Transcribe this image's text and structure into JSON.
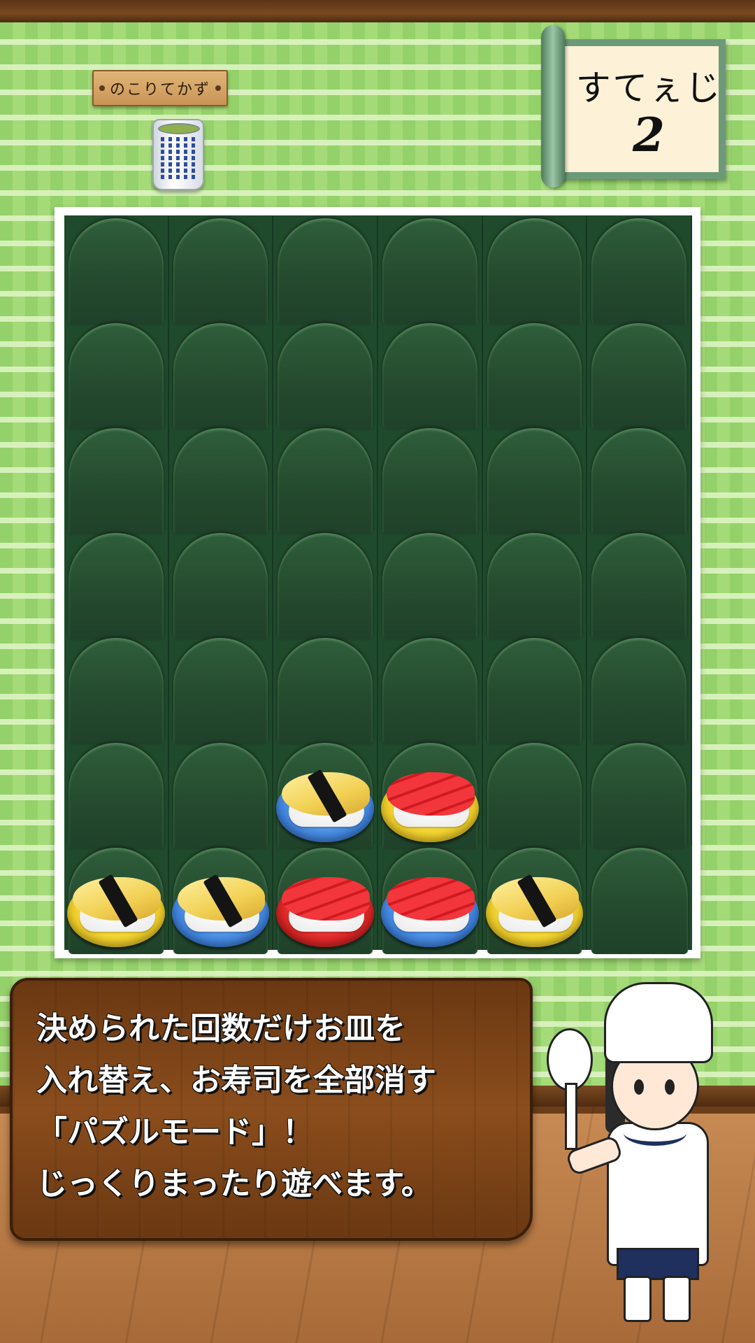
{
  "header": {
    "remaining_label": "のこりてかず",
    "stage_label": "すてぇじ",
    "stage_number": "2"
  },
  "board": {
    "columns": 6,
    "rows": 7,
    "pieces": [
      {
        "row": 5,
        "col": 2,
        "sushi": "tamago",
        "plate": "blue"
      },
      {
        "row": 5,
        "col": 3,
        "sushi": "tuna",
        "plate": "yellow"
      },
      {
        "row": 6,
        "col": 0,
        "sushi": "tamago",
        "plate": "yellow"
      },
      {
        "row": 6,
        "col": 1,
        "sushi": "tamago",
        "plate": "blue"
      },
      {
        "row": 6,
        "col": 2,
        "sushi": "tuna",
        "plate": "red"
      },
      {
        "row": 6,
        "col": 3,
        "sushi": "tuna",
        "plate": "blue"
      },
      {
        "row": 6,
        "col": 4,
        "sushi": "tamago",
        "plate": "yellow"
      }
    ]
  },
  "message": {
    "lines": [
      "決められた回数だけお皿を",
      "入れ替え、お寿司を全部消す",
      "「パズルモード」！",
      "じっくりまったり遊べます。"
    ]
  },
  "colors": {
    "wall": "#a4db78",
    "board": "#204a2c",
    "message_wood": "#7a431a",
    "plate_yellow": "#f3d431",
    "plate_blue": "#4a8fe4",
    "plate_red": "#e42b2b"
  }
}
